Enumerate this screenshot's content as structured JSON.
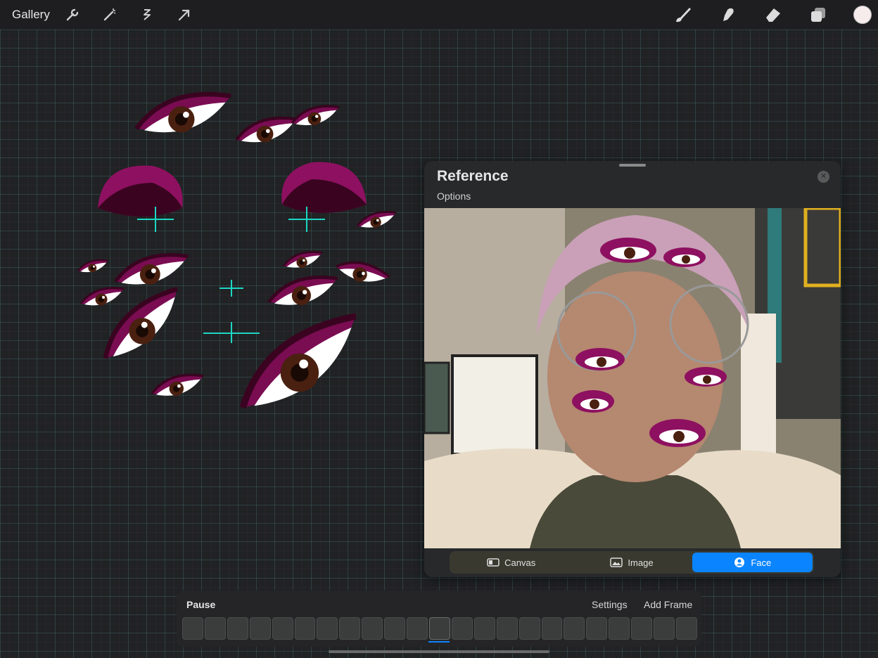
{
  "toolbar": {
    "gallery_label": "Gallery",
    "left_icons": [
      "wrench-icon",
      "magic-wand-icon",
      "selection-icon",
      "transform-arrow-icon"
    ],
    "right_icons": [
      "brush-icon",
      "smudge-icon",
      "eraser-icon",
      "layers-icon"
    ],
    "current_color": "#f7ecec"
  },
  "reference": {
    "title": "Reference",
    "options_label": "Options",
    "close_icon": "close-icon",
    "segments": [
      {
        "label": "Canvas",
        "icon": "canvas-icon",
        "active": false
      },
      {
        "label": "Image",
        "icon": "image-icon",
        "active": false
      },
      {
        "label": "Face",
        "icon": "face-icon",
        "active": true
      }
    ]
  },
  "animation": {
    "pause_label": "Pause",
    "settings_label": "Settings",
    "add_frame_label": "Add Frame",
    "frame_count": 23,
    "current_frame": 12
  },
  "colors": {
    "accent": "#0a84ff",
    "magenta": "#8e1060",
    "grid": "#3ca08c"
  }
}
